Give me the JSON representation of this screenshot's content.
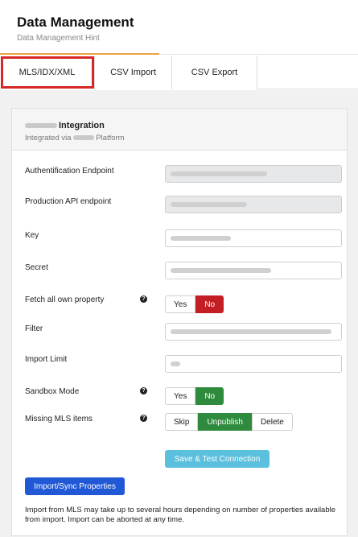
{
  "header": {
    "title": "Data Management",
    "hint": "Data Management Hint"
  },
  "tabs": [
    {
      "label": "MLS/IDX/XML",
      "active": true
    },
    {
      "label": "CSV Import",
      "active": false
    },
    {
      "label": "CSV Export",
      "active": false
    }
  ],
  "panel": {
    "title": "Integration",
    "subtitle_prefix": "Integrated via",
    "subtitle_suffix": "Platform"
  },
  "form": {
    "auth_endpoint_label": "Authentification Endpoint",
    "prod_api_label": "Production API endpoint",
    "key_label": "Key",
    "secret_label": "Secret",
    "fetch_label": "Fetch all own property",
    "filter_label": "Filter",
    "import_limit_label": "Import Limit",
    "sandbox_label": "Sandbox Mode",
    "missing_label": "Missing MLS items",
    "help_glyph": "?",
    "fetch_options": {
      "yes": "Yes",
      "no": "No",
      "selected": "No"
    },
    "sandbox_options": {
      "yes": "Yes",
      "no": "No",
      "selected": "No"
    },
    "missing_options": {
      "skip": "Skip",
      "unpublish": "Unpublish",
      "delete": "Delete",
      "selected": "Unpublish"
    }
  },
  "buttons": {
    "save_test": "Save & Test Connection",
    "import_sync": "Import/Sync Properties"
  },
  "note": "Import from MLS may take up to several hours depending on number of properties available from import. Import can be aborted at any time.",
  "colors": {
    "tab_highlight": "#d62828",
    "accent": "#e8a44a",
    "selected_no": "#c41e25",
    "selected_green": "#2e8b3d",
    "save_button": "#5bc0de",
    "import_button": "#2158d6"
  }
}
